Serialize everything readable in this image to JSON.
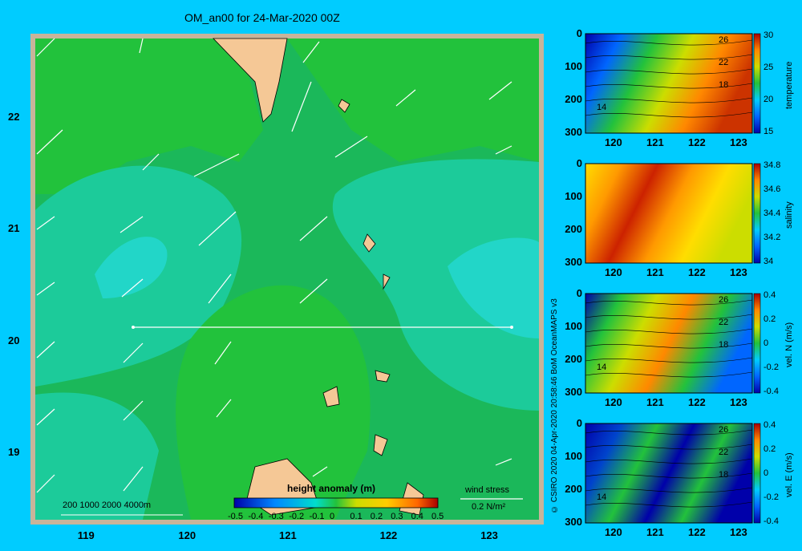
{
  "map": {
    "title": "OM_an00 for 24-Mar-2020 00Z",
    "lon_ticks": [
      "119",
      "120",
      "121",
      "122",
      "123"
    ],
    "lat_ticks": [
      "22",
      "21",
      "20",
      "19"
    ],
    "depth_scale": "200  1000  2000  4000m",
    "colorbar": {
      "label": "height anomaly  (m)",
      "ticks": [
        "-0.5",
        "-0.4",
        "-0.3",
        "-0.2",
        "-0.1",
        "0",
        "0.1",
        "0.2",
        "0.3",
        "0.4",
        "0.5"
      ]
    },
    "wind_label": "wind stress",
    "wind_scale": "0.2 N/m²"
  },
  "credit": "© CSIRO 2020   04-Apr-2020 20:58:46 BoM OceanMAPS v3",
  "panels": [
    {
      "label": "temperature",
      "cb_ticks": [
        "30",
        "25",
        "20",
        "15"
      ],
      "contours": [
        "26",
        "22",
        "18",
        "14"
      ]
    },
    {
      "label": "salinity",
      "cb_ticks": [
        "34.8",
        "34.6",
        "34.4",
        "34.2",
        "34"
      ],
      "contours": []
    },
    {
      "label": "vel. N  (m/s)",
      "cb_ticks": [
        "0.4",
        "0.2",
        "0",
        "-0.2",
        "-0.4"
      ],
      "contours": [
        "26",
        "22",
        "18",
        "14"
      ]
    },
    {
      "label": "vel. E  (m/s)",
      "cb_ticks": [
        "0.4",
        "0.2",
        "0",
        "-0.2",
        "-0.4"
      ],
      "contours": [
        "26",
        "22",
        "18",
        "14"
      ]
    }
  ],
  "panel_axes": {
    "x_ticks": [
      "120",
      "121",
      "122",
      "123"
    ],
    "y_ticks": [
      "0",
      "100",
      "200",
      "300"
    ]
  },
  "chart_data": {
    "type": "heatmap",
    "title": "OM_an00 for 24-Mar-2020 00Z",
    "x_range": [
      118.5,
      123.5
    ],
    "y_range": [
      18.4,
      22.7
    ],
    "value_label": "height anomaly  (m)",
    "value_range": [
      -0.5,
      0.5
    ],
    "section_latitude": 20,
    "section_lon_range": [
      119.5,
      123.2
    ]
  }
}
